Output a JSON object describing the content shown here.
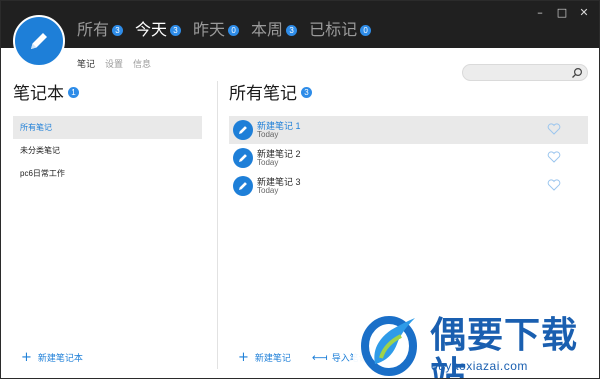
{
  "window": {
    "controls": {
      "minimize": "–",
      "maximize": "□",
      "close": "✕"
    }
  },
  "header": {
    "tabs": [
      {
        "label": "所有",
        "count": "3",
        "active": false
      },
      {
        "label": "今天",
        "count": "3",
        "active": true
      },
      {
        "label": "昨天",
        "count": "0",
        "active": false
      },
      {
        "label": "本周",
        "count": "3",
        "active": false
      },
      {
        "label": "已标记",
        "count": "0",
        "active": false
      }
    ],
    "subtabs": [
      {
        "label": "笔记",
        "active": true
      },
      {
        "label": "设置",
        "active": false
      },
      {
        "label": "信息",
        "active": false
      }
    ]
  },
  "search": {
    "placeholder": "",
    "value": "",
    "icon": "search-icon"
  },
  "notebooks": {
    "title": "笔记本",
    "count": "1",
    "items": [
      {
        "label": "所有笔记",
        "active": true
      },
      {
        "label": "未分类笔记",
        "active": false
      },
      {
        "label": "pc6日常工作",
        "active": false
      }
    ],
    "new_label": "新建笔记本"
  },
  "notes": {
    "title": "所有笔记",
    "count": "3",
    "items": [
      {
        "title": "新建笔记 1",
        "date": "Today",
        "active": true
      },
      {
        "title": "新建笔记 2",
        "date": "Today",
        "active": false
      },
      {
        "title": "新建笔记 3",
        "date": "Today",
        "active": false
      }
    ],
    "new_label": "新建笔记",
    "import_label": "导入笔记"
  },
  "watermark": {
    "title": "偶要下载站",
    "url": "ouyaoxiazai.com"
  },
  "colors": {
    "accent": "#1e7fd8",
    "header_bg": "#202020",
    "badge": "#2e8ce8",
    "selection_bg": "#e9e9e9"
  }
}
